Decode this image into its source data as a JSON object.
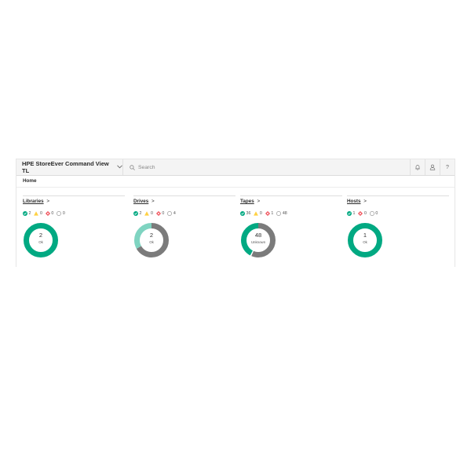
{
  "header": {
    "app_title": "HPE StoreEver Command View TL",
    "search_placeholder": "Search",
    "icons": [
      "bell-icon",
      "user-icon",
      "help-icon"
    ],
    "help_label": "?"
  },
  "breadcrumb": "Home",
  "colors": {
    "ok": "#01a982",
    "warning": "#ffd144",
    "critical": "#f04953",
    "unknown": "#9a9a9a",
    "light": "#7fd4c1",
    "gray": "#7b7b7b"
  },
  "panels": [
    {
      "title": "Libraries",
      "arrow": ">",
      "stats": {
        "ok": "2",
        "warning": "0",
        "critical": "0",
        "unknown": "0"
      },
      "donut": {
        "count": "2",
        "label": "Ok",
        "segments": [
          {
            "color": "#01a982",
            "fraction": 1.0
          }
        ]
      }
    },
    {
      "title": "Drives",
      "arrow": ">",
      "stats": {
        "ok": "2",
        "warning": "0",
        "critical": "0",
        "unknown": "4"
      },
      "donut": {
        "count": "2",
        "label": "Ok",
        "segments": [
          {
            "color": "#7b7b7b",
            "fraction": 0.667
          },
          {
            "color": "#7fd4c1",
            "fraction": 0.333
          }
        ]
      }
    },
    {
      "title": "Tapes",
      "arrow": ">",
      "stats": {
        "ok": "36",
        "warning": "0",
        "critical": "1",
        "unknown": "48"
      },
      "donut": {
        "count": "48",
        "label": "Unknown",
        "segments": [
          {
            "color": "#7b7b7b",
            "fraction": 0.565
          },
          {
            "color": "#ffffff",
            "fraction": 0.012
          },
          {
            "color": "#01a982",
            "fraction": 0.423
          }
        ]
      }
    },
    {
      "title": "Hosts",
      "arrow": ">",
      "stats": {
        "ok": "1",
        "critical": "0",
        "unknown": "0"
      },
      "donut": {
        "count": "1",
        "label": "Ok",
        "segments": [
          {
            "color": "#01a982",
            "fraction": 1.0
          }
        ]
      }
    }
  ]
}
